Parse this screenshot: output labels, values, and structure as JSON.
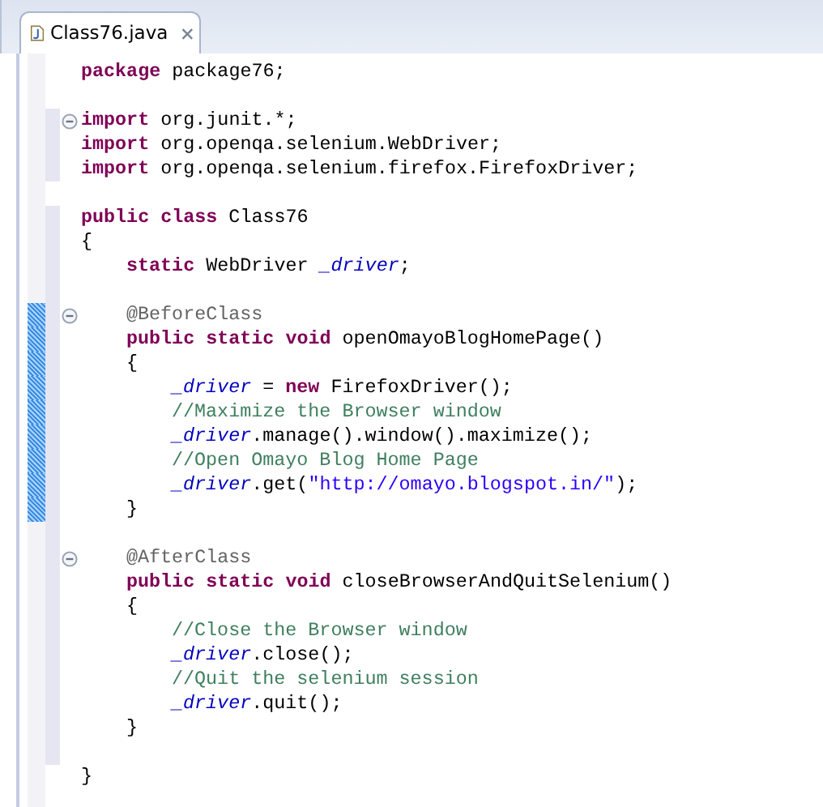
{
  "tab": {
    "title": "Class76.java",
    "selected": true
  },
  "lines": [
    {
      "kind": "code",
      "tokens": [
        {
          "kind": "keyword",
          "text": "package"
        },
        {
          "kind": "plain",
          "text": " package76;"
        }
      ]
    },
    {
      "kind": "blank"
    },
    {
      "kind": "code",
      "foldable": true,
      "range": true,
      "tokens": [
        {
          "kind": "keyword",
          "text": "import"
        },
        {
          "kind": "plain",
          "text": " org.junit.*;"
        }
      ]
    },
    {
      "kind": "code",
      "range": true,
      "tokens": [
        {
          "kind": "keyword",
          "text": "import"
        },
        {
          "kind": "plain",
          "text": " org.openqa.selenium.WebDriver;"
        }
      ]
    },
    {
      "kind": "code",
      "range": true,
      "tokens": [
        {
          "kind": "keyword",
          "text": "import"
        },
        {
          "kind": "plain",
          "text": " org.openqa.selenium.firefox.FirefoxDriver;"
        }
      ]
    },
    {
      "kind": "blank"
    },
    {
      "kind": "code",
      "range": true,
      "tokens": [
        {
          "kind": "keyword",
          "text": "public class"
        },
        {
          "kind": "plain",
          "text": " Class76"
        }
      ]
    },
    {
      "kind": "code",
      "range": true,
      "tokens": [
        {
          "kind": "plain",
          "text": "{"
        }
      ],
      "children": [
        {
          "kind": "code",
          "range": true,
          "tokens": [
            {
              "kind": "keyword",
              "text": "static"
            },
            {
              "kind": "plain",
              "text": " WebDriver "
            },
            {
              "kind": "field",
              "text": "_driver"
            },
            {
              "kind": "plain",
              "text": ";"
            }
          ]
        },
        {
          "kind": "blank",
          "range": true
        },
        {
          "kind": "code",
          "foldable": true,
          "range": true,
          "changed": true,
          "tokens": [
            {
              "kind": "annotation",
              "text": "@BeforeClass"
            }
          ]
        },
        {
          "kind": "code",
          "range": true,
          "changed": true,
          "tokens": [
            {
              "kind": "keyword",
              "text": "public static void"
            },
            {
              "kind": "plain",
              "text": " openOmayoBlogHomePage()"
            }
          ]
        },
        {
          "kind": "code",
          "range": true,
          "changed": true,
          "tokens": [
            {
              "kind": "plain",
              "text": "{"
            }
          ],
          "children": [
            {
              "kind": "code",
              "range": true,
              "changed": true,
              "tokens": [
                {
                  "kind": "field",
                  "text": "_driver"
                },
                {
                  "kind": "plain",
                  "text": " = "
                },
                {
                  "kind": "keyword",
                  "text": "new"
                },
                {
                  "kind": "plain",
                  "text": " FirefoxDriver();"
                }
              ]
            },
            {
              "kind": "code",
              "range": true,
              "changed": true,
              "tokens": [
                {
                  "kind": "comment",
                  "text": "//Maximize the Browser window"
                }
              ]
            },
            {
              "kind": "code",
              "range": true,
              "changed": true,
              "tokens": [
                {
                  "kind": "field",
                  "text": "_driver"
                },
                {
                  "kind": "plain",
                  "text": ".manage().window().maximize();"
                }
              ]
            },
            {
              "kind": "code",
              "range": true,
              "changed": true,
              "tokens": [
                {
                  "kind": "comment",
                  "text": "//Open Omayo Blog Home Page"
                }
              ]
            },
            {
              "kind": "code",
              "range": true,
              "changed": true,
              "tokens": [
                {
                  "kind": "field",
                  "text": "_driver"
                },
                {
                  "kind": "plain",
                  "text": ".get("
                },
                {
                  "kind": "string",
                  "text": "\"http://omayo.blogspot.in/\""
                },
                {
                  "kind": "plain",
                  "text": ");"
                }
              ]
            }
          ]
        },
        {
          "kind": "code",
          "range": true,
          "changed": true,
          "tokens": [
            {
              "kind": "plain",
              "text": "}"
            }
          ]
        },
        {
          "kind": "blank",
          "range": true
        },
        {
          "kind": "code",
          "foldable": true,
          "range": true,
          "tokens": [
            {
              "kind": "annotation",
              "text": "@AfterClass"
            }
          ]
        },
        {
          "kind": "code",
          "range": true,
          "tokens": [
            {
              "kind": "keyword",
              "text": "public static void"
            },
            {
              "kind": "plain",
              "text": " closeBrowserAndQuitSelenium()"
            }
          ]
        },
        {
          "kind": "code",
          "range": true,
          "tokens": [
            {
              "kind": "plain",
              "text": "{"
            }
          ],
          "children": [
            {
              "kind": "code",
              "range": true,
              "tokens": [
                {
                  "kind": "comment",
                  "text": "//Close the Browser window"
                }
              ]
            },
            {
              "kind": "code",
              "range": true,
              "tokens": [
                {
                  "kind": "field",
                  "text": "_driver"
                },
                {
                  "kind": "plain",
                  "text": ".close();"
                }
              ]
            },
            {
              "kind": "code",
              "range": true,
              "tokens": [
                {
                  "kind": "comment",
                  "text": "//Quit the selenium session"
                }
              ]
            },
            {
              "kind": "code",
              "range": true,
              "tokens": [
                {
                  "kind": "field",
                  "text": "_driver"
                },
                {
                  "kind": "plain",
                  "text": ".quit();"
                }
              ]
            }
          ]
        },
        {
          "kind": "code",
          "range": true,
          "tokens": [
            {
              "kind": "plain",
              "text": "}"
            }
          ]
        },
        {
          "kind": "blank",
          "range": true
        }
      ]
    },
    {
      "kind": "code",
      "tokens": [
        {
          "kind": "plain",
          "text": "}"
        }
      ]
    }
  ]
}
